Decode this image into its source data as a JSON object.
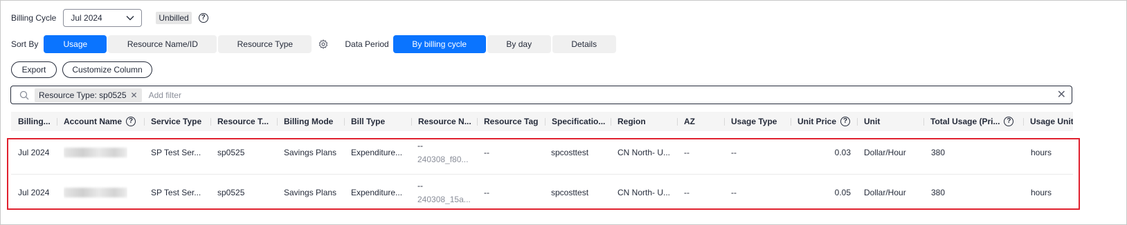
{
  "billing_cycle": {
    "label": "Billing Cycle",
    "value": "Jul 2024",
    "status_badge": "Unbilled"
  },
  "sort_by": {
    "label": "Sort By",
    "options": [
      "Usage",
      "Resource Name/ID",
      "Resource Type"
    ],
    "active": "Usage"
  },
  "data_period": {
    "label": "Data Period",
    "options": [
      "By billing cycle",
      "By day",
      "Details"
    ],
    "active": "By billing cycle"
  },
  "actions": {
    "export": "Export",
    "customize": "Customize Column"
  },
  "filter": {
    "chip": "Resource Type: sp0525",
    "placeholder": "Add filter"
  },
  "table": {
    "columns": [
      "Billing...",
      "Account Name",
      "Service Type",
      "Resource T...",
      "Billing Mode",
      "Bill Type",
      "Resource N...",
      "Resource Tag",
      "Specificatio...",
      "Region",
      "AZ",
      "Usage Type",
      "Unit Price",
      "Unit",
      "Total Usage (Pri...",
      "Usage Unit"
    ],
    "rows": [
      {
        "billing": "Jul 2024",
        "service": "SP Test Ser...",
        "restype": "sp0525",
        "mode": "Savings Plans",
        "billtype": "Expenditure...",
        "resname1": "--",
        "resname2": "240308_f80...",
        "tag": "--",
        "spec": "spcosttest",
        "region": "CN North- U...",
        "az": "--",
        "usagetype": "--",
        "price": "0.03",
        "unit": "Dollar/Hour",
        "total": "380",
        "usageunit": "hours"
      },
      {
        "billing": "Jul 2024",
        "service": "SP Test Ser...",
        "restype": "sp0525",
        "mode": "Savings Plans",
        "billtype": "Expenditure...",
        "resname1": "--",
        "resname2": "240308_15a...",
        "tag": "--",
        "spec": "spcosttest",
        "region": "CN North- U...",
        "az": "--",
        "usagetype": "--",
        "price": "0.05",
        "unit": "Dollar/Hour",
        "total": "380",
        "usageunit": "hours"
      }
    ]
  },
  "colors": {
    "primary": "#0a74ff",
    "highlight_border": "#e0212f"
  }
}
